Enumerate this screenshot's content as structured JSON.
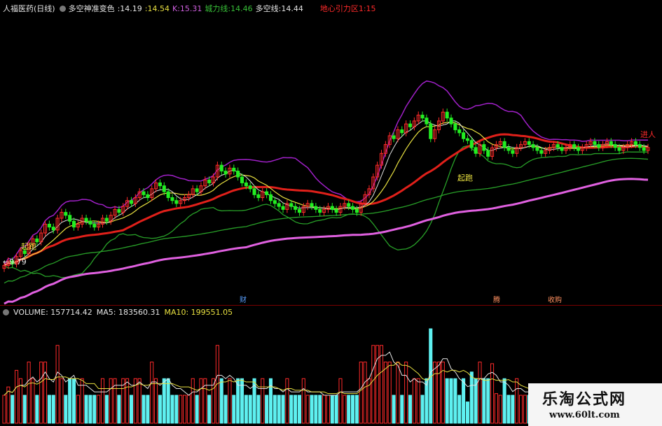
{
  "header": {
    "title": "人福医药(日线)",
    "indicator_name": "多空神准变色",
    "v1": ":14.19",
    "v2": ":14.54",
    "k_label": "K:15.31",
    "support_label": "城力线:14.46",
    "duokong_label": "多空线:14.44",
    "gravity_label": "地心引力区1:15"
  },
  "volume_header": {
    "volume": "VOLUME: 157714.42",
    "ma5": "MA5: 183560.31",
    "ma10": "MA10: 199551.05"
  },
  "annotations": {
    "low_price": "9.79",
    "start_label": "起跑",
    "mid_label": "起跑",
    "enter_label": "进人",
    "event_cai": "财",
    "event_teng": "腾",
    "event_shou": "收购"
  },
  "watermark": {
    "line1": "乐淘公式网",
    "line2": "www.60lt.com"
  },
  "colors": {
    "up": "#ff2a2a",
    "down": "#22ee22",
    "red_ma": "#e0201a",
    "purple": "#a020c8",
    "magenta": "#e060e0",
    "green_line": "#28a028",
    "yellow": "#e8e040",
    "white_line": "#e0e0e0",
    "volume_cyan": "#5ef0f0"
  },
  "chart_data": {
    "type": "candlestick",
    "title": "人福医药(日线)",
    "x": [
      0,
      1,
      2,
      3,
      4,
      5,
      6,
      7,
      8,
      9,
      10,
      11,
      12,
      13,
      14,
      15,
      16,
      17,
      18,
      19,
      20,
      21,
      22,
      23,
      24,
      25,
      26,
      27,
      28,
      29,
      30,
      31,
      32,
      33,
      34,
      35,
      36,
      37,
      38,
      39,
      40,
      41,
      42,
      43,
      44,
      45,
      46,
      47,
      48,
      49,
      50,
      51,
      52,
      53,
      54,
      55,
      56,
      57,
      58,
      59,
      60,
      61,
      62,
      63,
      64,
      65,
      66,
      67,
      68,
      69,
      70,
      71,
      72,
      73,
      74,
      75,
      76,
      77,
      78,
      79,
      80,
      81,
      82,
      83,
      84,
      85,
      86,
      87,
      88,
      89,
      90,
      91,
      92,
      93,
      94,
      95,
      96,
      97,
      98,
      99,
      100,
      101,
      102,
      103,
      104,
      105,
      106,
      107,
      108,
      109,
      110,
      111,
      112,
      113,
      114,
      115,
      116,
      117,
      118,
      119,
      120,
      121,
      122,
      123,
      124,
      125,
      126,
      127,
      128,
      129,
      130,
      131,
      132,
      133,
      134,
      135,
      136,
      137,
      138,
      139,
      140,
      141,
      142,
      143,
      144,
      145,
      146,
      147,
      148,
      149,
      150,
      151,
      152,
      153,
      154,
      155,
      156,
      157,
      158,
      159
    ],
    "close": [
      10.2,
      10.35,
      10.25,
      10.5,
      10.7,
      10.6,
      10.9,
      11.1,
      11.0,
      11.3,
      11.6,
      11.5,
      11.4,
      11.8,
      12.0,
      11.9,
      11.7,
      11.5,
      11.6,
      11.8,
      11.7,
      11.6,
      11.5,
      11.6,
      11.8,
      11.7,
      11.9,
      12.1,
      12.0,
      12.2,
      12.4,
      12.3,
      12.5,
      12.7,
      12.6,
      12.5,
      12.8,
      13.0,
      12.9,
      12.7,
      12.5,
      12.4,
      12.3,
      12.4,
      12.5,
      12.6,
      12.8,
      12.7,
      12.9,
      13.1,
      13.0,
      13.2,
      13.6,
      13.4,
      13.3,
      13.5,
      13.4,
      13.2,
      13.0,
      12.9,
      12.8,
      12.6,
      12.5,
      12.7,
      12.6,
      12.4,
      12.3,
      12.2,
      12.1,
      12.3,
      12.2,
      12.1,
      12.0,
      12.2,
      12.3,
      12.2,
      12.1,
      12.0,
      12.1,
      12.2,
      12.1,
      12.0,
      12.2,
      12.3,
      12.2,
      12.1,
      12.0,
      12.3,
      12.6,
      12.8,
      13.2,
      13.6,
      14.0,
      14.3,
      14.6,
      14.5,
      14.8,
      14.7,
      15.0,
      14.9,
      15.1,
      15.3,
      15.2,
      15.0,
      14.5,
      14.8,
      15.1,
      15.4,
      15.2,
      15.0,
      14.8,
      14.7,
      14.5,
      14.44,
      14.2,
      14.0,
      14.3,
      14.1,
      13.9,
      14.19,
      14.3,
      14.4,
      14.2,
      14.1,
      14.0,
      14.2,
      14.3,
      14.4,
      14.3,
      14.2,
      14.1,
      14.0,
      14.1,
      14.2,
      14.3,
      14.2,
      14.1,
      14.2,
      14.3,
      14.2,
      14.1,
      14.2,
      14.3,
      14.4,
      14.3,
      14.2,
      14.3,
      14.4,
      14.3,
      14.2,
      14.1,
      14.2,
      14.3,
      14.4,
      14.3,
      14.2,
      14.1,
      14.2
    ],
    "ylim": [
      9.0,
      16.0
    ]
  }
}
